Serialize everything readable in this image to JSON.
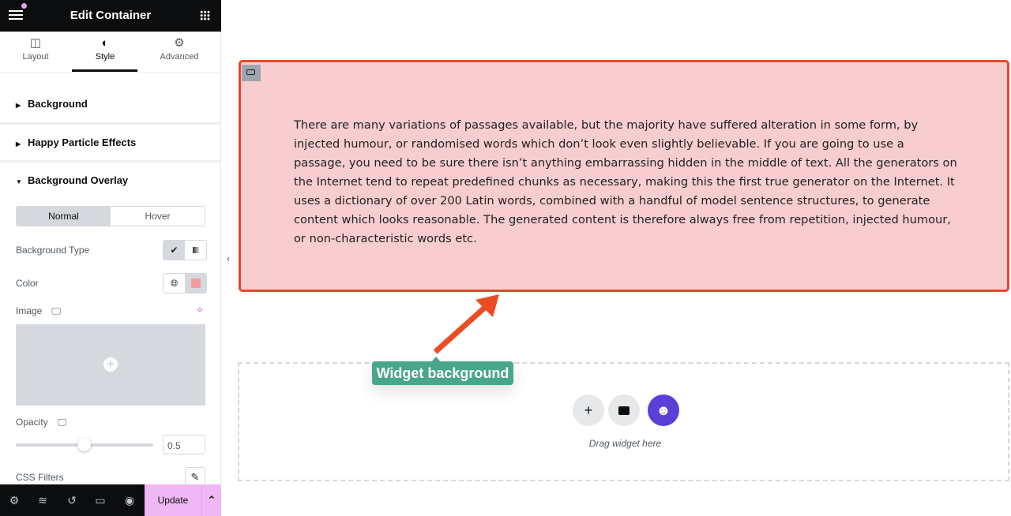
{
  "header": {
    "title": "Edit Container"
  },
  "tabs": [
    {
      "label": "Layout",
      "icon": "columns-icon"
    },
    {
      "label": "Style",
      "icon": "half-circle-icon",
      "active": true
    },
    {
      "label": "Advanced",
      "icon": "gear-icon"
    }
  ],
  "sections": {
    "background": "Background",
    "particles": "Happy Particle Effects",
    "overlay": "Background Overlay"
  },
  "overlay": {
    "state_tabs": [
      "Normal",
      "Hover"
    ],
    "background_type_label": "Background Type",
    "color_label": "Color",
    "color_value": "#f29aa0",
    "image_label": "Image",
    "opacity_label": "Opacity",
    "opacity_value": "0.5",
    "css_filters_label": "CSS Filters"
  },
  "footer": {
    "update": "Update"
  },
  "canvas": {
    "paragraph": "There are many variations of passages available, but the majority have suffered alteration in some form, by injected humour, or randomised words which don’t look even slightly believable. If you are going to use a passage, you need to be sure there isn’t anything embarrassing hidden in the middle of text. All the generators on the Internet tend to repeat predefined chunks as necessary, making this the first true generator on the Internet. It uses a dictionary of over 200 Latin words, combined with a handful of model sentence structures, to generate content which looks reasonable. The generated content is therefore always free from repetition, injected humour, or non-characteristic words etc.",
    "drop_label": "Drag widget here",
    "annotation": "Widget background",
    "colors": {
      "container_border": "#e8472a",
      "container_fill": "#f7cdcf",
      "annotation": "#47a68c",
      "happy_addons": "#5b3fd6"
    }
  }
}
